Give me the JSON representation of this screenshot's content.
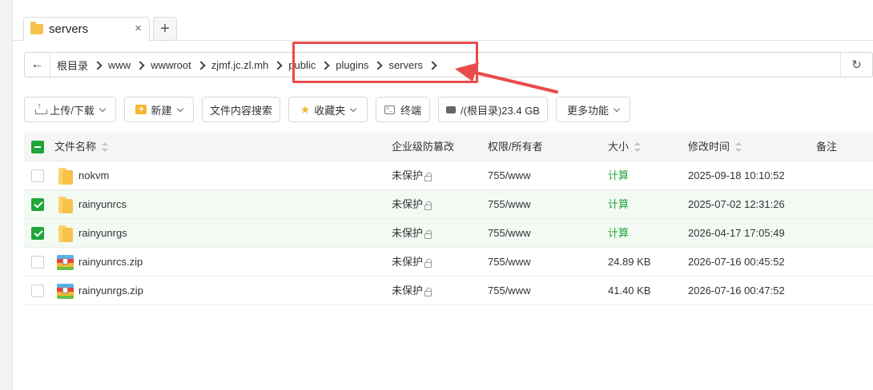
{
  "tabs": [
    {
      "label": "servers",
      "close": "×"
    }
  ],
  "tab_add": "+",
  "breadcrumb": {
    "back": "←",
    "items": [
      "根目录",
      "www",
      "wwwroot",
      "zjmf.jc.zl.mh",
      "public",
      "plugins",
      "servers"
    ],
    "refresh": "↻"
  },
  "toolbar": {
    "upload": "上传/下载",
    "new": "新建",
    "new_icon": "+",
    "search_content": "文件内容搜索",
    "favorites": "收藏夹",
    "terminal": "终端",
    "terminal_icon": ">_",
    "disk": "/(根目录)23.4 GB",
    "more": "更多功能"
  },
  "table": {
    "columns": {
      "name": "文件名称",
      "tamper": "企业级防篡改",
      "perm": "权限/所有者",
      "size": "大小",
      "mtime": "修改时间",
      "note": "备注"
    },
    "rows": [
      {
        "name": "nokvm",
        "type": "folder",
        "checked": false,
        "tamper": "未保护",
        "perm": "755/www",
        "size": "计算",
        "mtime": "2025-09-18 10:10:52"
      },
      {
        "name": "rainyunrcs",
        "type": "folder",
        "checked": true,
        "tamper": "未保护",
        "perm": "755/www",
        "size": "计算",
        "mtime": "2025-07-02 12:31:26"
      },
      {
        "name": "rainyunrgs",
        "type": "folder",
        "checked": true,
        "tamper": "未保护",
        "perm": "755/www",
        "size": "计算",
        "mtime": "2026-04-17 17:05:49"
      },
      {
        "name": "rainyunrcs.zip",
        "type": "zip",
        "checked": false,
        "tamper": "未保护",
        "perm": "755/www",
        "size": "24.89 KB",
        "mtime": "2026-07-16 00:45:52"
      },
      {
        "name": "rainyunrgs.zip",
        "type": "zip",
        "checked": false,
        "tamper": "未保护",
        "perm": "755/www",
        "size": "41.40 KB",
        "mtime": "2026-07-16 00:47:52"
      }
    ]
  },
  "annotation": {
    "color": "#e94b4b"
  }
}
